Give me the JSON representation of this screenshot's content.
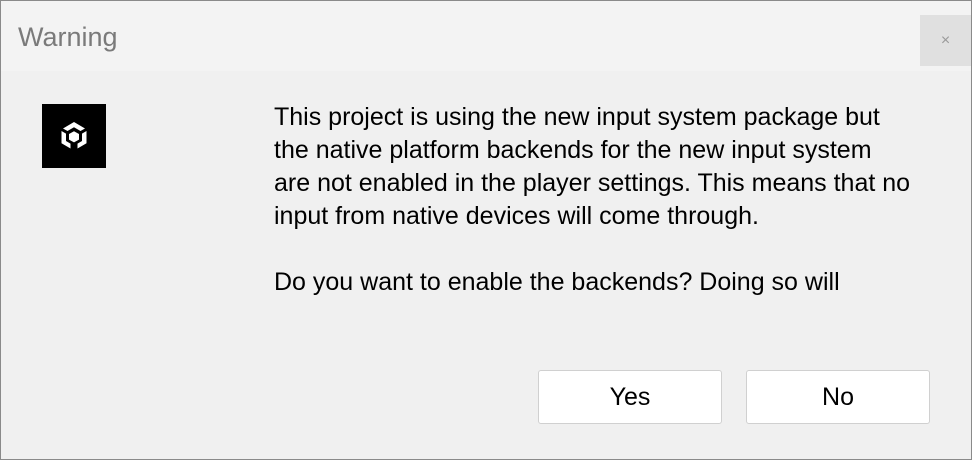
{
  "window": {
    "title": "Warning",
    "close_label": "×"
  },
  "icon": {
    "name": "unity-logo-icon",
    "background": "#000000"
  },
  "message": {
    "paragraph1": "This project is using the new input system package but the native platform backends for the new input system are not enabled in the player settings. This means that no input from native devices will come through.",
    "paragraph2": "Do you want to enable the backends? Doing so will"
  },
  "buttons": {
    "yes_label": "Yes",
    "no_label": "No"
  }
}
